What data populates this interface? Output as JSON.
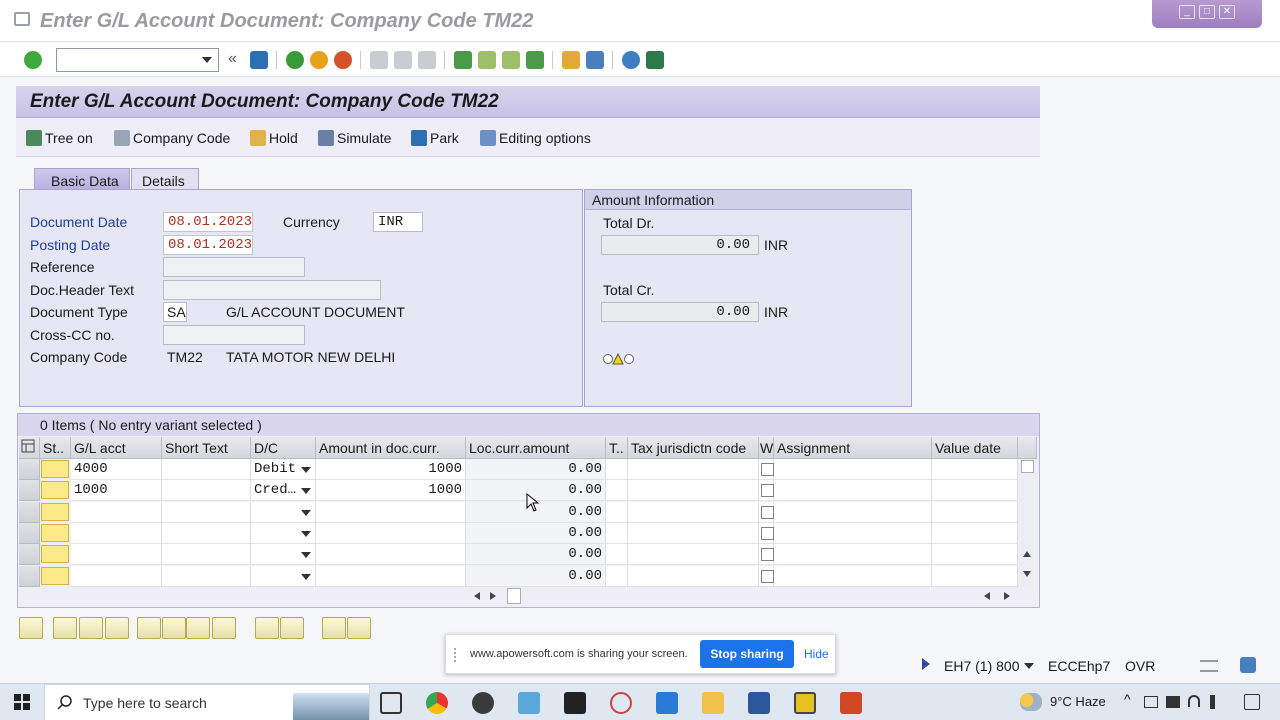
{
  "window": {
    "title": "Enter G/L Account Document: Company Code TM22"
  },
  "screen": {
    "title": "Enter G/L Account Document: Company Code TM22"
  },
  "app_toolbar": {
    "tree_on": "Tree on",
    "company_code": "Company Code",
    "hold": "Hold",
    "simulate": "Simulate",
    "park": "Park",
    "editing_options": "Editing options"
  },
  "tabs": {
    "basic_data": "Basic Data",
    "details": "Details"
  },
  "basic": {
    "document_date_label": "Document Date",
    "document_date": "08.01.2023",
    "currency_label": "Currency",
    "currency": "INR",
    "posting_date_label": "Posting Date",
    "posting_date": "08.01.2023",
    "reference_label": "Reference",
    "doc_header_label": "Doc.Header Text",
    "doc_type_label": "Document Type",
    "doc_type": "SA",
    "doc_type_desc": "G/L ACCOUNT DOCUMENT",
    "cross_cc_label": "Cross-CC no.",
    "company_code_label": "Company Code",
    "company_code": "TM22",
    "company_name": "TATA MOTOR NEW DELHI"
  },
  "amount": {
    "caption": "Amount Information",
    "total_dr_label": "Total Dr.",
    "total_dr": "0.00",
    "total_dr_cur": "INR",
    "total_cr_label": "Total Cr.",
    "total_cr": "0.00",
    "total_cr_cur": "INR"
  },
  "table": {
    "caption": "0 Items ( No entry variant selected )",
    "columns": [
      "St..",
      "G/L acct",
      "Short Text",
      "D/C",
      "Amount in doc.curr.",
      "Loc.curr.amount",
      "T..",
      "Tax jurisdictn code",
      "W",
      "Assignment",
      "Value date"
    ],
    "rows": [
      {
        "gl": "4000",
        "dc": "Debit",
        "amt": "1000",
        "loc": "0.00"
      },
      {
        "gl": "1000",
        "dc": "Cred…",
        "amt": "1000",
        "loc": "0.00"
      },
      {
        "gl": "",
        "dc": "",
        "amt": "",
        "loc": "0.00"
      },
      {
        "gl": "",
        "dc": "",
        "amt": "",
        "loc": "0.00"
      },
      {
        "gl": "",
        "dc": "",
        "amt": "",
        "loc": "0.00"
      },
      {
        "gl": "",
        "dc": "",
        "amt": "",
        "loc": "0.00"
      }
    ]
  },
  "share": {
    "text": "www.apowersoft.com is sharing your screen.",
    "stop": "Stop sharing",
    "hide": "Hide"
  },
  "status": {
    "system": "EH7 (1) 800",
    "server": "ECCEhp7",
    "mode": "OVR"
  },
  "taskbar": {
    "search_placeholder": "Type here to search",
    "weather": "9°C  Haze"
  }
}
